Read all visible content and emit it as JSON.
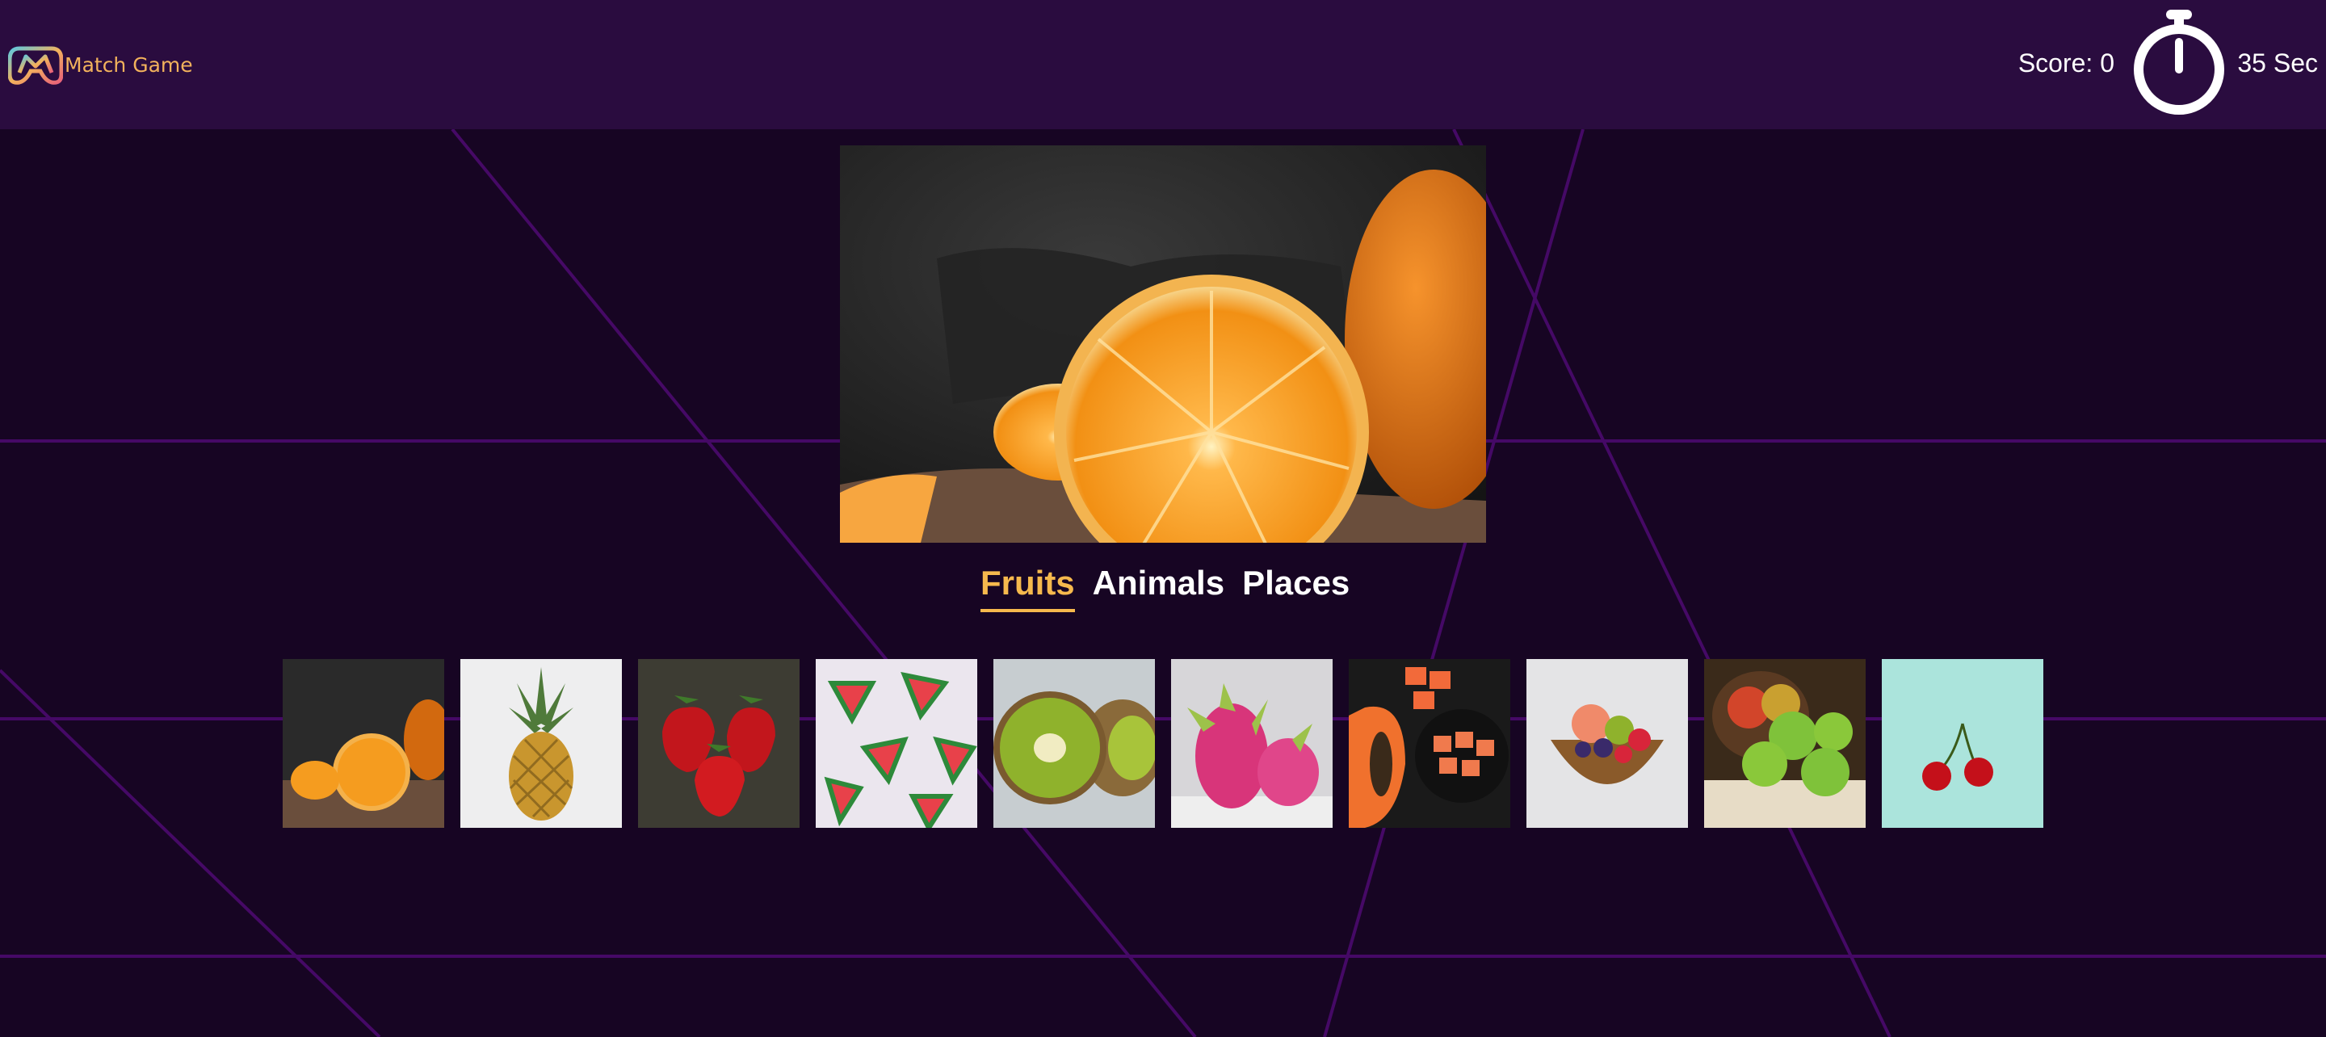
{
  "app": {
    "title": "Match Game"
  },
  "header": {
    "score_label": "Score: 0",
    "timer_label": "35 Sec"
  },
  "icons": {
    "logo": "gamepad-logo-icon",
    "timer": "stopwatch-icon"
  },
  "colors": {
    "background": "#170523",
    "navbar": "#2a0c3f",
    "accent": "#f6b94d",
    "grid_lines": "#4b0a6e"
  },
  "hero": {
    "subject": "halved orange"
  },
  "tabs": [
    {
      "label": "Fruits",
      "active": true
    },
    {
      "label": "Animals",
      "active": false
    },
    {
      "label": "Places",
      "active": false
    }
  ],
  "thumbnails": [
    "orange",
    "pineapple",
    "strawberries",
    "watermelon",
    "kiwi",
    "dragon fruit",
    "papaya",
    "fruit bowl",
    "apples",
    "cherries"
  ]
}
